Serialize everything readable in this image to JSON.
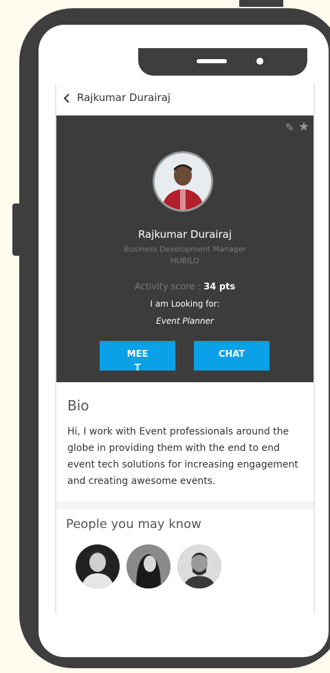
{
  "header": {
    "back_icon": "chevron-left-icon",
    "title": "Rajkumar Durairaj"
  },
  "profile": {
    "edit_icon": "pencil-icon",
    "favorite_icon": "star-icon",
    "name": "Rajkumar Durairaj",
    "job_title": "Business Development Manager",
    "company": "HUBILO",
    "activity_label": "Activity score : ",
    "activity_value": "34 pts",
    "looking_for_label": "I am Looking for:",
    "looking_for_value": "Event Planner"
  },
  "actions": {
    "meet_label": "MEET",
    "chat_label": "CHAT",
    "accent_color": "#0aa1e8"
  },
  "bio": {
    "heading": "Bio",
    "text": "Hi, I work with Event professionals around the globe in providing them with the end to end event tech solutions for increasing engagement and creating awesome events."
  },
  "people": {
    "heading": "People you may know",
    "avatars": [
      "person-avatar-1",
      "person-avatar-2",
      "person-avatar-3"
    ]
  }
}
